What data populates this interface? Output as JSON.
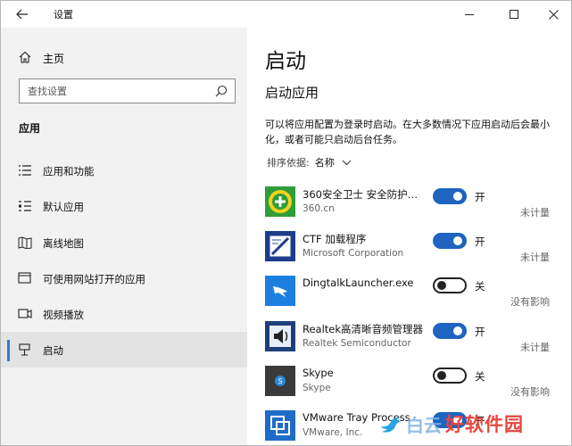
{
  "window": {
    "title": "设置"
  },
  "sidebar": {
    "home_label": "主页",
    "search_placeholder": "查找设置",
    "section_title": "应用",
    "items": [
      {
        "label": "应用和功能",
        "icon": "list-icon"
      },
      {
        "label": "默认应用",
        "icon": "default-apps-icon"
      },
      {
        "label": "离线地图",
        "icon": "map-icon"
      },
      {
        "label": "可使用网站打开的应用",
        "icon": "web-app-icon"
      },
      {
        "label": "视频播放",
        "icon": "video-icon"
      },
      {
        "label": "启动",
        "icon": "startup-icon",
        "selected": true
      }
    ]
  },
  "main": {
    "title": "启动",
    "subtitle": "启动应用",
    "description": "可以将应用配置为登录时启动。在大多数情况下应用启动后会最小化，或者可能只启动后台任务。",
    "sort_label": "排序依据:",
    "sort_value": "名称",
    "apps": [
      {
        "name": "360安全卫士 安全防护中...",
        "publisher": "360.cn",
        "state": "开",
        "on": true,
        "impact": "未计量",
        "icon": "360-icon"
      },
      {
        "name": "CTF 加载程序",
        "publisher": "Microsoft Corporation",
        "state": "开",
        "on": true,
        "impact": "未计量",
        "icon": "ctf-loader-icon"
      },
      {
        "name": "DingtalkLauncher.exe",
        "publisher": "",
        "state": "关",
        "on": false,
        "impact": "没有影响",
        "icon": "dingtalk-icon"
      },
      {
        "name": "Realtek高清晰音频管理器",
        "publisher": "Realtek Semiconductor",
        "state": "开",
        "on": true,
        "impact": "未计量",
        "icon": "realtek-speaker-icon"
      },
      {
        "name": "Skype",
        "publisher": "Skype",
        "state": "关",
        "on": false,
        "impact": "没有影响",
        "icon": "skype-icon"
      },
      {
        "name": "VMware Tray Process",
        "publisher": "VMware, Inc.",
        "state": "开",
        "on": true,
        "impact": "",
        "icon": "vmware-icon"
      }
    ]
  },
  "watermark": {
    "text_a": "白云",
    "text_b": "好软件园"
  },
  "colors": {
    "accent": "#1e64c0",
    "sidebar_bg": "#f2f2f2",
    "selected_bar": "#2f7bd6"
  }
}
